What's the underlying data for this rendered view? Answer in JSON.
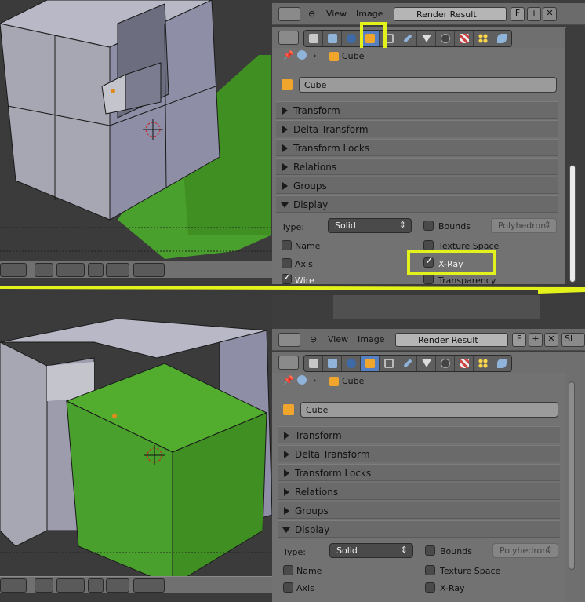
{
  "image_editor": {
    "menu_view": "View",
    "menu_image": "Image",
    "render_result": "Render Result",
    "fake_user": "F",
    "slot_partial": "Sl"
  },
  "properties": {
    "breadcrumb": "Cube",
    "object_name": "Cube",
    "tabs": [
      "render-icon",
      "scene-icon",
      "world-icon",
      "object-icon",
      "constraints-icon",
      "modifiers-icon",
      "data-icon",
      "material-icon",
      "texture-icon",
      "particles-icon",
      "physics-icon"
    ],
    "sections": {
      "transform": "Transform",
      "delta_transform": "Delta Transform",
      "transform_locks": "Transform Locks",
      "relations": "Relations",
      "groups": "Groups",
      "display": "Display"
    },
    "display": {
      "type_label": "Type:",
      "type_value": "Solid",
      "bounds": "Bounds",
      "bounds_type": "Polyhedron",
      "name": "Name",
      "texture_space": "Texture Space",
      "axis": "Axis",
      "xray": "X-Ray",
      "wire": "Wire",
      "transparency": "Transparency"
    }
  },
  "top_state": {
    "xray_checked": true,
    "wire_checked": true
  },
  "bottom_state": {
    "xray_checked": false,
    "wire_checked": false
  },
  "colors": {
    "highlight": "#e2f21a",
    "cube_green": "#4aa02c",
    "active_tab": "#5680c2"
  }
}
